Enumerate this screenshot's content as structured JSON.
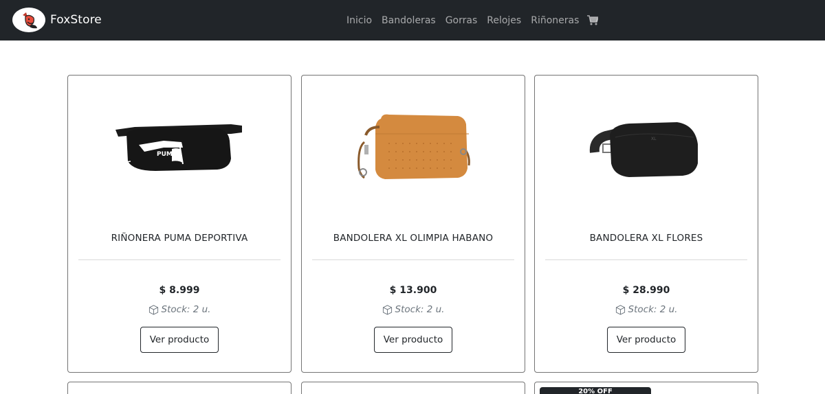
{
  "brand": {
    "name": "FoxStore"
  },
  "nav": {
    "links": [
      "Inicio",
      "Bandoleras",
      "Gorras",
      "Relojes",
      "Riñoneras"
    ],
    "cart_icon": "shopping-cart-icon"
  },
  "products": [
    {
      "title": "RIÑONERA PUMA DEPORTIVA",
      "price": "$ 8.999",
      "stock": "Stock: 2 u.",
      "button": "Ver producto"
    },
    {
      "title": "BANDOLERA XL OLIMPIA HABANO",
      "price": "$ 13.900",
      "stock": "Stock: 2 u.",
      "button": "Ver producto"
    },
    {
      "title": "BANDOLERA XL FLORES",
      "price": "$ 28.990",
      "stock": "Stock: 2 u.",
      "button": "Ver producto"
    }
  ],
  "next_row": {
    "badge": "20% OFF"
  },
  "colors": {
    "navbar": "#212529",
    "orange_bag": "#d58a3f",
    "black_bag": "#1f1f1f"
  }
}
